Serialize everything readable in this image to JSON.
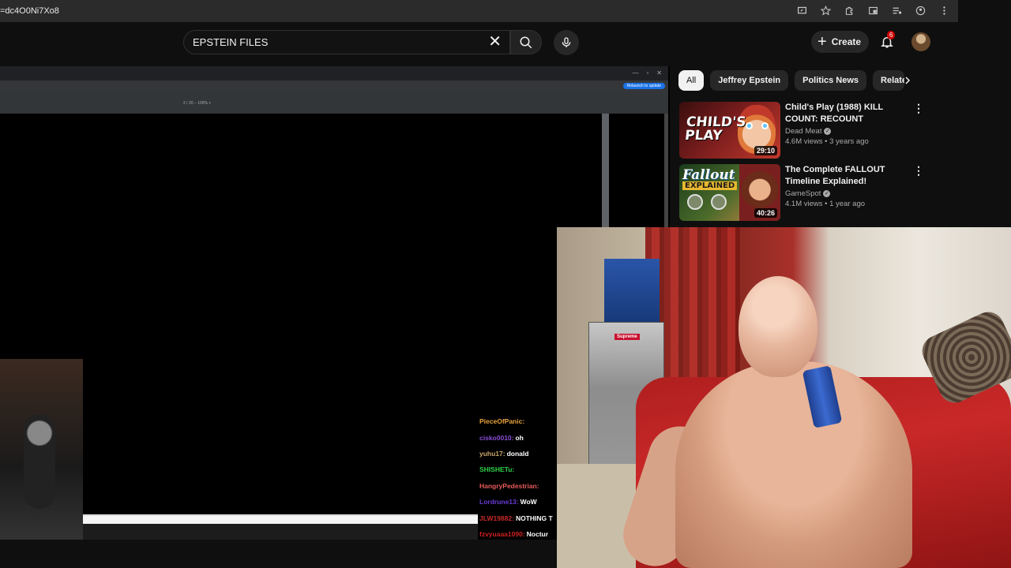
{
  "browser": {
    "url": "=dc4O0Ni7Xo8"
  },
  "masthead": {
    "search_query": "EPSTEIN FILES",
    "create_label": "Create",
    "notification_count": "6"
  },
  "pdf_viewer": {
    "toolbar_text": "2 / 20   −  100%  +",
    "relaunch_label": "Relaunch to update"
  },
  "chips": [
    {
      "label": "All",
      "active": true
    },
    {
      "label": "Jeffrey Epstein",
      "active": false
    },
    {
      "label": "Politics News",
      "active": false
    },
    {
      "label": "Relate",
      "active": false
    }
  ],
  "videos": [
    {
      "thumb_text": "CHILD'S PLAY",
      "duration": "29:10",
      "title": "Child's Play (1988) KILL COUNT: RECOUNT",
      "channel": "Dead Meat",
      "stats": "4.6M views • 3 years ago"
    },
    {
      "thumb_text": "Fallout",
      "thumb_sub": "EXPLAINED",
      "duration": "40:26",
      "title": "The Complete FALLOUT Timeline Explained!",
      "channel": "GameSpot",
      "stats": "4.1M views • 1 year ago"
    }
  ],
  "webcam": {
    "fridge_label": "Supreme"
  },
  "chat": [
    {
      "user": "PieceOfPanic:",
      "msg": "",
      "color": "#e8a23a"
    },
    {
      "user": "cisko0010:",
      "msg": "oh",
      "color": "#8a4dd6"
    },
    {
      "user": "yuhu17:",
      "msg": "donald",
      "color": "#c9a66b"
    },
    {
      "user": "SHISHETu:",
      "msg": "",
      "color": "#2fcf4a"
    },
    {
      "user": "HangryPedestrian:",
      "msg": "",
      "color": "#e85a5a"
    },
    {
      "user": "Lordrune13:",
      "msg": "WoW",
      "color": "#6a3ad6"
    },
    {
      "user": "JLW19882:",
      "msg": "NOTHING T",
      "color": "#c82a2a"
    },
    {
      "user": "fzvyuaaa1090:",
      "msg": "Noctur",
      "color": "#d02020"
    }
  ],
  "icons": {
    "search": "search-icon",
    "clear": "close-icon",
    "mic": "mic-icon",
    "bell": "bell-icon",
    "more": "more-vert-icon",
    "next": "chevron-right-icon"
  },
  "colors": {
    "background": "#0f0f0f",
    "chip_active": "#f1f1f1",
    "badge": "#cc0000"
  }
}
